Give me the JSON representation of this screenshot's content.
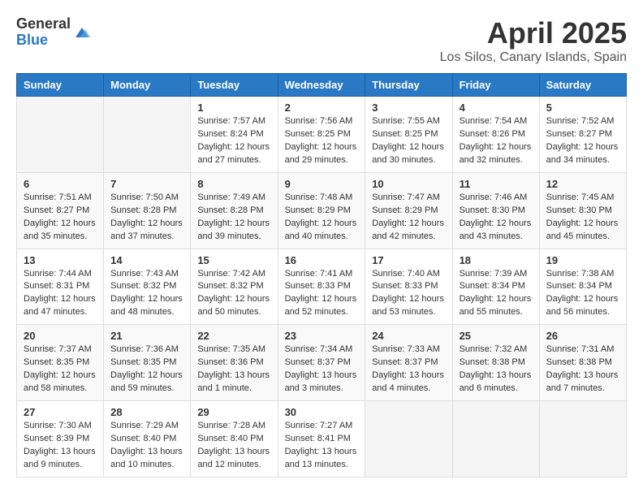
{
  "header": {
    "logo_general": "General",
    "logo_blue": "Blue",
    "month_title": "April 2025",
    "location": "Los Silos, Canary Islands, Spain"
  },
  "columns": [
    "Sunday",
    "Monday",
    "Tuesday",
    "Wednesday",
    "Thursday",
    "Friday",
    "Saturday"
  ],
  "weeks": [
    [
      {
        "day": "",
        "info": ""
      },
      {
        "day": "",
        "info": ""
      },
      {
        "day": "1",
        "info": "Sunrise: 7:57 AM\nSunset: 8:24 PM\nDaylight: 12 hours and 27 minutes."
      },
      {
        "day": "2",
        "info": "Sunrise: 7:56 AM\nSunset: 8:25 PM\nDaylight: 12 hours and 29 minutes."
      },
      {
        "day": "3",
        "info": "Sunrise: 7:55 AM\nSunset: 8:25 PM\nDaylight: 12 hours and 30 minutes."
      },
      {
        "day": "4",
        "info": "Sunrise: 7:54 AM\nSunset: 8:26 PM\nDaylight: 12 hours and 32 minutes."
      },
      {
        "day": "5",
        "info": "Sunrise: 7:52 AM\nSunset: 8:27 PM\nDaylight: 12 hours and 34 minutes."
      }
    ],
    [
      {
        "day": "6",
        "info": "Sunrise: 7:51 AM\nSunset: 8:27 PM\nDaylight: 12 hours and 35 minutes."
      },
      {
        "day": "7",
        "info": "Sunrise: 7:50 AM\nSunset: 8:28 PM\nDaylight: 12 hours and 37 minutes."
      },
      {
        "day": "8",
        "info": "Sunrise: 7:49 AM\nSunset: 8:28 PM\nDaylight: 12 hours and 39 minutes."
      },
      {
        "day": "9",
        "info": "Sunrise: 7:48 AM\nSunset: 8:29 PM\nDaylight: 12 hours and 40 minutes."
      },
      {
        "day": "10",
        "info": "Sunrise: 7:47 AM\nSunset: 8:29 PM\nDaylight: 12 hours and 42 minutes."
      },
      {
        "day": "11",
        "info": "Sunrise: 7:46 AM\nSunset: 8:30 PM\nDaylight: 12 hours and 43 minutes."
      },
      {
        "day": "12",
        "info": "Sunrise: 7:45 AM\nSunset: 8:30 PM\nDaylight: 12 hours and 45 minutes."
      }
    ],
    [
      {
        "day": "13",
        "info": "Sunrise: 7:44 AM\nSunset: 8:31 PM\nDaylight: 12 hours and 47 minutes."
      },
      {
        "day": "14",
        "info": "Sunrise: 7:43 AM\nSunset: 8:32 PM\nDaylight: 12 hours and 48 minutes."
      },
      {
        "day": "15",
        "info": "Sunrise: 7:42 AM\nSunset: 8:32 PM\nDaylight: 12 hours and 50 minutes."
      },
      {
        "day": "16",
        "info": "Sunrise: 7:41 AM\nSunset: 8:33 PM\nDaylight: 12 hours and 52 minutes."
      },
      {
        "day": "17",
        "info": "Sunrise: 7:40 AM\nSunset: 8:33 PM\nDaylight: 12 hours and 53 minutes."
      },
      {
        "day": "18",
        "info": "Sunrise: 7:39 AM\nSunset: 8:34 PM\nDaylight: 12 hours and 55 minutes."
      },
      {
        "day": "19",
        "info": "Sunrise: 7:38 AM\nSunset: 8:34 PM\nDaylight: 12 hours and 56 minutes."
      }
    ],
    [
      {
        "day": "20",
        "info": "Sunrise: 7:37 AM\nSunset: 8:35 PM\nDaylight: 12 hours and 58 minutes."
      },
      {
        "day": "21",
        "info": "Sunrise: 7:36 AM\nSunset: 8:35 PM\nDaylight: 12 hours and 59 minutes."
      },
      {
        "day": "22",
        "info": "Sunrise: 7:35 AM\nSunset: 8:36 PM\nDaylight: 13 hours and 1 minute."
      },
      {
        "day": "23",
        "info": "Sunrise: 7:34 AM\nSunset: 8:37 PM\nDaylight: 13 hours and 3 minutes."
      },
      {
        "day": "24",
        "info": "Sunrise: 7:33 AM\nSunset: 8:37 PM\nDaylight: 13 hours and 4 minutes."
      },
      {
        "day": "25",
        "info": "Sunrise: 7:32 AM\nSunset: 8:38 PM\nDaylight: 13 hours and 6 minutes."
      },
      {
        "day": "26",
        "info": "Sunrise: 7:31 AM\nSunset: 8:38 PM\nDaylight: 13 hours and 7 minutes."
      }
    ],
    [
      {
        "day": "27",
        "info": "Sunrise: 7:30 AM\nSunset: 8:39 PM\nDaylight: 13 hours and 9 minutes."
      },
      {
        "day": "28",
        "info": "Sunrise: 7:29 AM\nSunset: 8:40 PM\nDaylight: 13 hours and 10 minutes."
      },
      {
        "day": "29",
        "info": "Sunrise: 7:28 AM\nSunset: 8:40 PM\nDaylight: 13 hours and 12 minutes."
      },
      {
        "day": "30",
        "info": "Sunrise: 7:27 AM\nSunset: 8:41 PM\nDaylight: 13 hours and 13 minutes."
      },
      {
        "day": "",
        "info": ""
      },
      {
        "day": "",
        "info": ""
      },
      {
        "day": "",
        "info": ""
      }
    ]
  ]
}
